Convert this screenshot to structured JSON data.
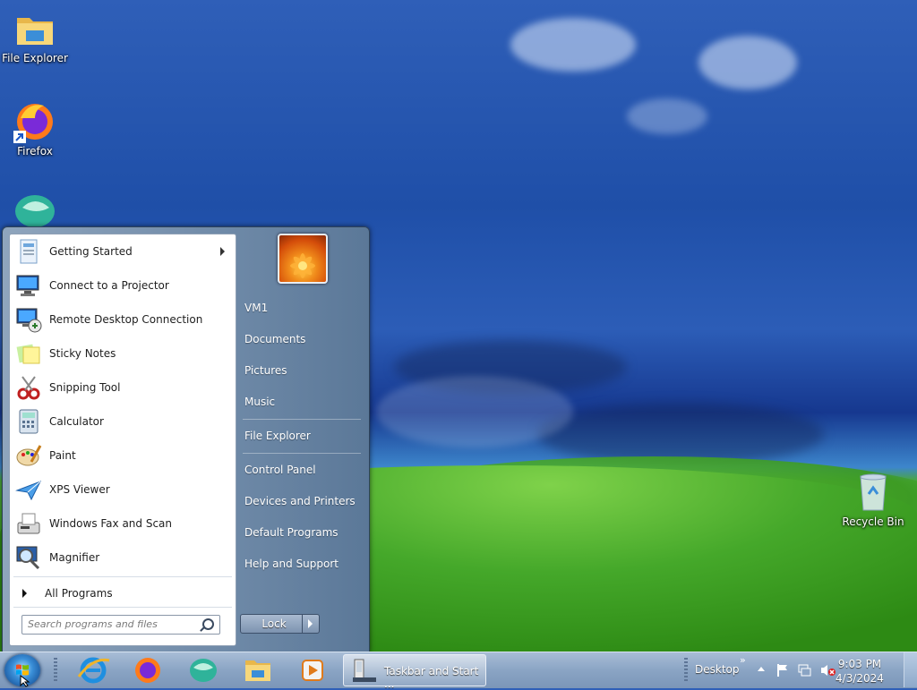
{
  "desktop": {
    "icons": [
      {
        "label": "File Explorer",
        "icon": "file-explorer-icon"
      },
      {
        "label": "Firefox",
        "icon": "firefox-icon"
      },
      {
        "label": "",
        "icon": "internet-browser-icon"
      },
      {
        "label": "Recycle Bin",
        "icon": "recycle-bin-icon"
      }
    ]
  },
  "start_menu": {
    "programs": [
      {
        "label": "Getting Started",
        "icon": "getting-started-icon",
        "has_submenu": true
      },
      {
        "label": "Connect to a Projector",
        "icon": "projector-icon"
      },
      {
        "label": "Remote Desktop Connection",
        "icon": "remote-desktop-icon"
      },
      {
        "label": "Sticky Notes",
        "icon": "sticky-notes-icon"
      },
      {
        "label": "Snipping Tool",
        "icon": "snipping-tool-icon"
      },
      {
        "label": "Calculator",
        "icon": "calculator-icon"
      },
      {
        "label": "Paint",
        "icon": "paint-icon"
      },
      {
        "label": "XPS Viewer",
        "icon": "xps-viewer-icon"
      },
      {
        "label": "Windows Fax and Scan",
        "icon": "fax-scan-icon"
      },
      {
        "label": "Magnifier",
        "icon": "magnifier-icon"
      }
    ],
    "all_programs": "All Programs",
    "search_placeholder": "Search programs and files",
    "user": "VM1",
    "right_items": [
      "Documents",
      "Pictures",
      "Music",
      "File Explorer",
      "Control Panel",
      "Devices and Printers",
      "Default Programs",
      "Help and Support"
    ],
    "lock_label": "Lock"
  },
  "taskbar": {
    "pinned": [
      "internet-explorer-icon",
      "firefox-icon",
      "browser-icon",
      "file-explorer-icon",
      "media-player-icon"
    ],
    "active_task": "Taskbar and Start ...",
    "toolbar_label": "Desktop",
    "time": "9:03 PM",
    "date": "4/3/2024"
  }
}
